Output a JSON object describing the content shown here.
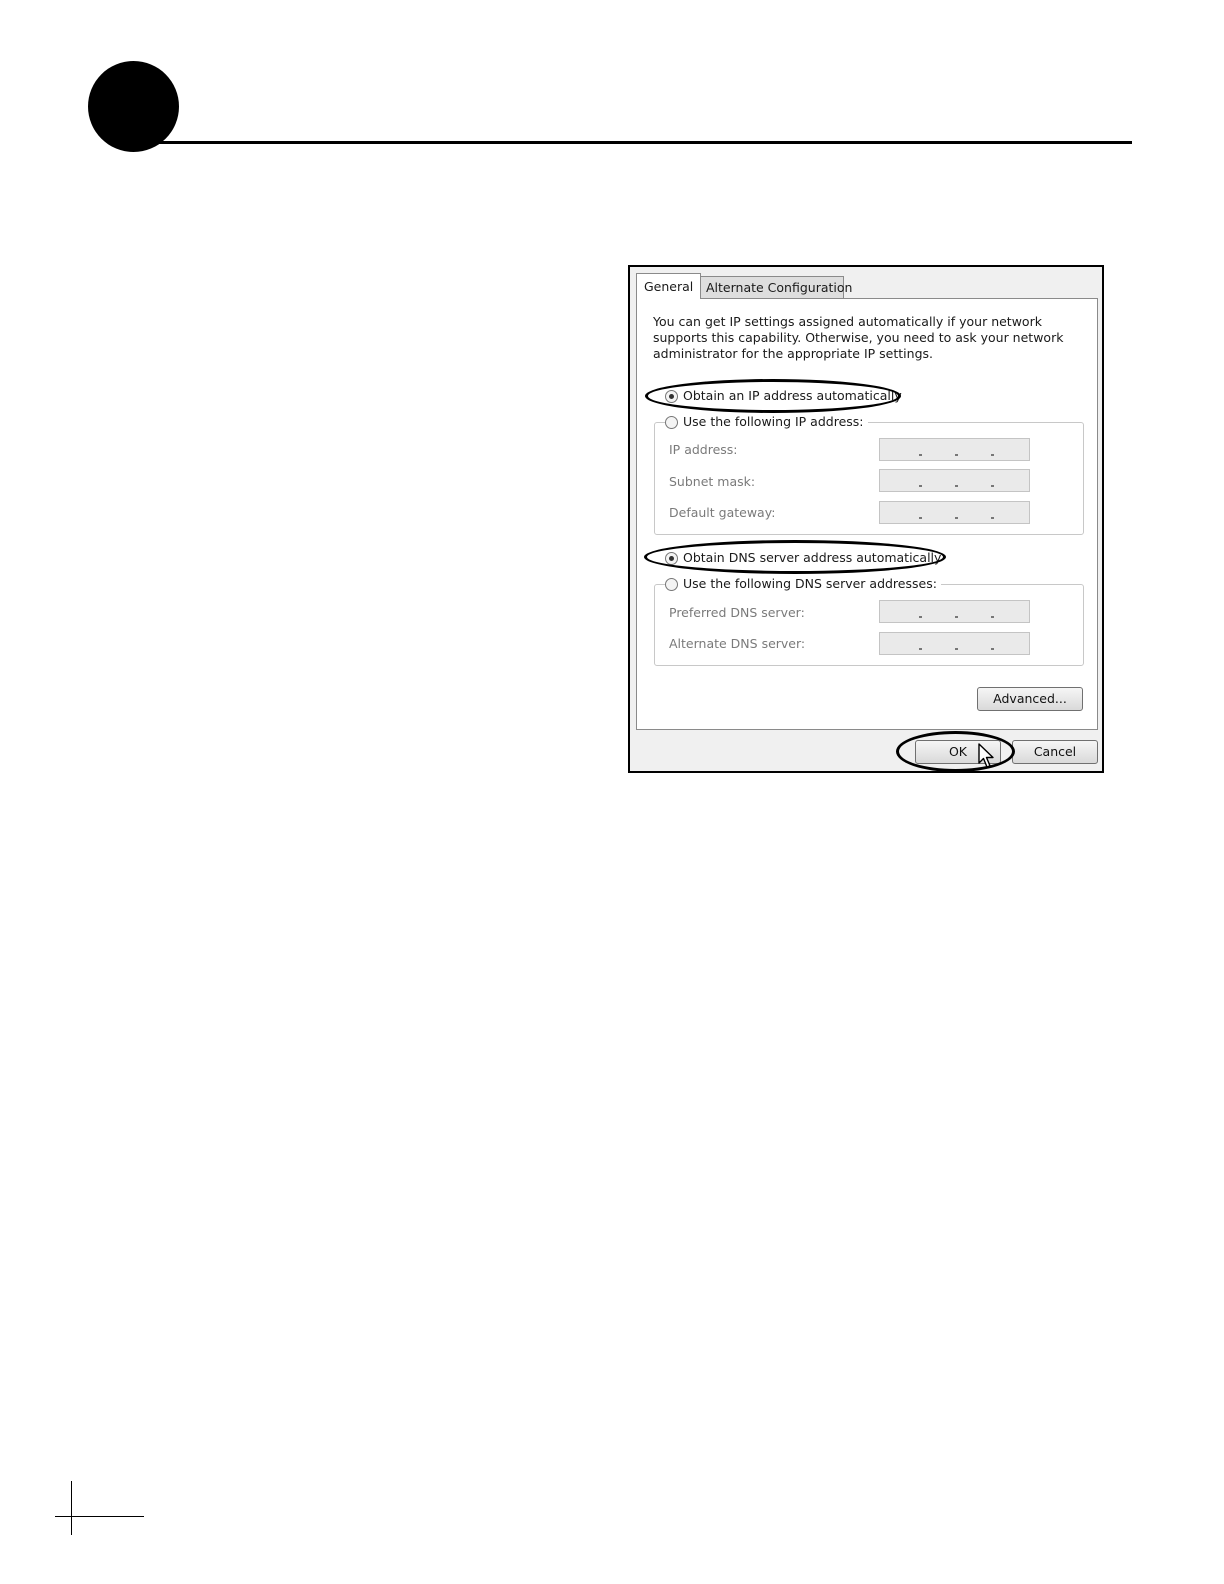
{
  "dialog": {
    "tabs": [
      {
        "label": "General",
        "active": true
      },
      {
        "label": "Alternate Configuration",
        "active": false
      }
    ],
    "intro": "You can get IP settings assigned automatically if your network supports this capability. Otherwise, you need to ask your network administrator for the appropriate IP settings.",
    "ip_auto": {
      "label": "Obtain an IP address automatically",
      "checked": true
    },
    "ip_manual": {
      "label": "Use the following IP address:",
      "checked": false
    },
    "ip_fields": [
      {
        "label": "IP address:",
        "value": ""
      },
      {
        "label": "Subnet mask:",
        "value": ""
      },
      {
        "label": "Default gateway:",
        "value": ""
      }
    ],
    "dns_auto": {
      "label": "Obtain DNS server address automatically",
      "checked": true
    },
    "dns_manual": {
      "label": "Use the following DNS server addresses:",
      "checked": false
    },
    "dns_fields": [
      {
        "label": "Preferred DNS server:",
        "value": ""
      },
      {
        "label": "Alternate DNS server:",
        "value": ""
      }
    ],
    "advanced_label": "Advanced...",
    "ok_label": "OK",
    "cancel_label": "Cancel"
  },
  "colors": {
    "panel": "#ffffff",
    "dialog_bg": "#f0f0f0",
    "disabled_text": "#7a7a7a"
  },
  "icons": [
    "mouse-pointer-icon"
  ]
}
